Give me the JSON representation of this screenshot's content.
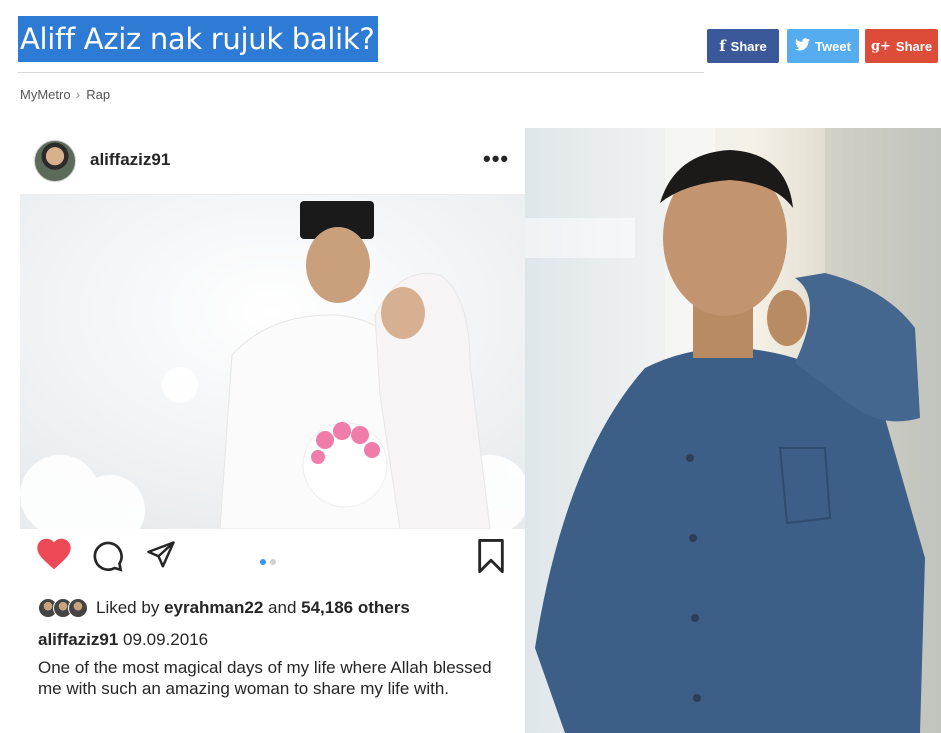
{
  "article": {
    "title": "Aliff Aziz nak rujuk balik?",
    "breadcrumb": [
      "MyMetro",
      "Rap"
    ]
  },
  "share": {
    "facebook": {
      "icon": "facebook-icon",
      "glyph": "f",
      "label": "Share",
      "color": "#3b5998"
    },
    "twitter": {
      "icon": "twitter-icon",
      "glyph": "🐦",
      "label": "Tweet",
      "color": "#55acee"
    },
    "googleplus": {
      "icon": "google-plus-icon",
      "glyph": "g+",
      "label": "Share",
      "color": "#dd4b39"
    }
  },
  "instagram": {
    "username": "aliffaziz91",
    "liked_prefix": "Liked by",
    "liked_user": "eyrahman22",
    "liked_and": "and",
    "liked_others": "54,186 others",
    "caption_user": "aliffaziz91",
    "caption_date": "09.09.2016",
    "caption_text": "One of the most magical days of my life where Allah blessed me with such an amazing woman to share my life with.",
    "like_color": "#ed4956",
    "dot_active_color": "#3897f0"
  }
}
